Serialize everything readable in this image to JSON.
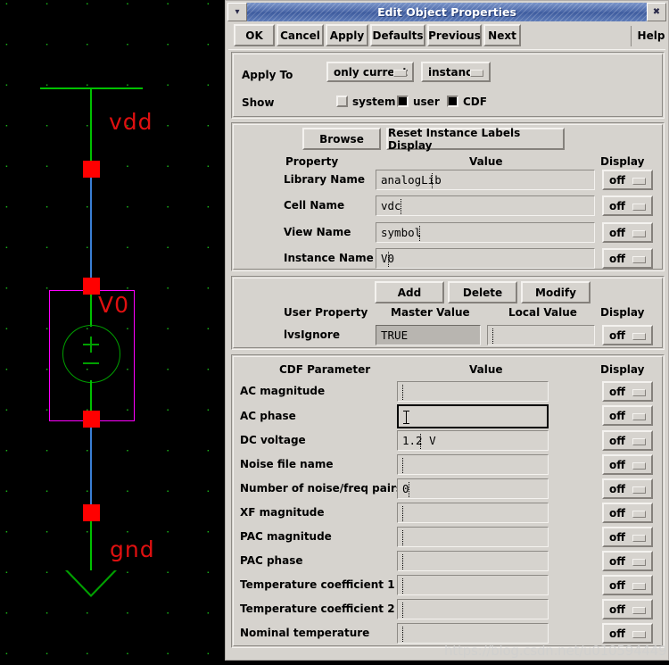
{
  "window": {
    "title": "Edit Object Properties",
    "menu_icon": "chevron-down-icon",
    "close_icon": "close-icon"
  },
  "toolbar": {
    "buttons": [
      {
        "label": "OK",
        "name": "ok-button"
      },
      {
        "label": "Cancel",
        "name": "cancel-button"
      },
      {
        "label": "Apply",
        "name": "apply-button"
      },
      {
        "label": "Defaults",
        "name": "defaults-button"
      },
      {
        "label": "Previous",
        "name": "previous-button"
      },
      {
        "label": "Next",
        "name": "next-button"
      }
    ],
    "help_label": "Help"
  },
  "apply_section": {
    "apply_to_label": "Apply To",
    "scope_value": "only current",
    "target_value": "instance",
    "show_label": "Show",
    "checkboxes": [
      {
        "label": "system",
        "checked": false
      },
      {
        "label": "user",
        "checked": true
      },
      {
        "label": "CDF",
        "checked": true
      }
    ]
  },
  "property_section": {
    "browse_label": "Browse",
    "reset_label": "Reset Instance Labels Display",
    "headers": {
      "property": "Property",
      "value": "Value",
      "display": "Display"
    },
    "rows": [
      {
        "label": "Library Name",
        "value": "analogLib",
        "display": "off"
      },
      {
        "label": "Cell Name",
        "value": "vdc",
        "display": "off"
      },
      {
        "label": "View Name",
        "value": "symbol",
        "display": "off"
      },
      {
        "label": "Instance Name",
        "value": "V0",
        "display": "off"
      }
    ]
  },
  "user_property_section": {
    "add_label": "Add",
    "delete_label": "Delete",
    "modify_label": "Modify",
    "headers": {
      "property": "User Property",
      "master": "Master Value",
      "local": "Local Value",
      "display": "Display"
    },
    "rows": [
      {
        "label": "lvsIgnore",
        "master": "TRUE",
        "local": "",
        "display": "off"
      }
    ]
  },
  "cdf_section": {
    "headers": {
      "parameter": "CDF Parameter",
      "value": "Value",
      "display": "Display"
    },
    "rows": [
      {
        "label": "AC magnitude",
        "value": "",
        "display": "off",
        "focused": false
      },
      {
        "label": "AC phase",
        "value": "",
        "display": "off",
        "focused": true
      },
      {
        "label": "DC voltage",
        "value": "1.2 V",
        "display": "off",
        "focused": false
      },
      {
        "label": "Noise file name",
        "value": "",
        "display": "off",
        "focused": false
      },
      {
        "label": "Number of noise/freq pairs",
        "value": "0",
        "display": "off",
        "focused": false
      },
      {
        "label": "XF magnitude",
        "value": "",
        "display": "off",
        "focused": false
      },
      {
        "label": "PAC magnitude",
        "value": "",
        "display": "off",
        "focused": false
      },
      {
        "label": "PAC phase",
        "value": "",
        "display": "off",
        "focused": false
      },
      {
        "label": "Temperature coefficient 1",
        "value": "",
        "display": "off",
        "focused": false
      },
      {
        "label": "Temperature coefficient 2",
        "value": "",
        "display": "off",
        "focused": false
      },
      {
        "label": "Nominal temperature",
        "value": "",
        "display": "off",
        "focused": false
      }
    ]
  },
  "schematic": {
    "vdd_label": "vdd",
    "gnd_label": "gnd",
    "instance_label": "V0",
    "source_plus": "+",
    "source_minus": "−",
    "colors": {
      "wire_green": "#00c000",
      "wire_blue": "#3a7fd5",
      "pin_red": "#ff0000",
      "label_red": "#e01010",
      "selection_magenta": "#ff00ff",
      "grid_dot": "#19b319",
      "background": "#000000"
    }
  },
  "watermark": {
    "text": "https://blog.csdn.net/u010594449"
  }
}
